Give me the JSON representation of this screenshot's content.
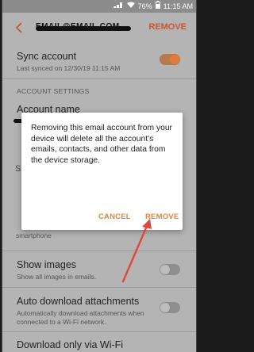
{
  "status_bar": {
    "battery": "76%",
    "time": "11:15 AM",
    "icons": [
      "signal-icon",
      "wifi-icon",
      "battery-icon"
    ]
  },
  "app_bar": {
    "account_email": "EMAIL@EMAIL.COM",
    "remove_label": "REMOVE"
  },
  "settings": {
    "sync": {
      "title": "Sync account",
      "subtitle": "Last synced on 12/30/19  11:15 AM",
      "enabled": true
    },
    "section_header": "ACCOUNT SETTINGS",
    "account_name_title": "Account name",
    "partial_row_s_label": "S",
    "partial_smartphone_label": "smartphone",
    "show_images": {
      "title": "Show images",
      "subtitle": "Show all images in emails.",
      "enabled": false
    },
    "auto_download": {
      "title": "Auto download attachments",
      "subtitle": "Automatically download attachments when connected to a Wi-Fi network.",
      "enabled": false
    },
    "download_wifi": {
      "title": "Download only via Wi-Fi"
    }
  },
  "dialog": {
    "message": "Removing this email account from your device will delete all the account's emails, contacts, and other data from the device storage.",
    "cancel_label": "CANCEL",
    "remove_label": "REMOVE"
  },
  "colors": {
    "accent": "#e07a3e",
    "annotation_arrow": "#e0473c"
  }
}
